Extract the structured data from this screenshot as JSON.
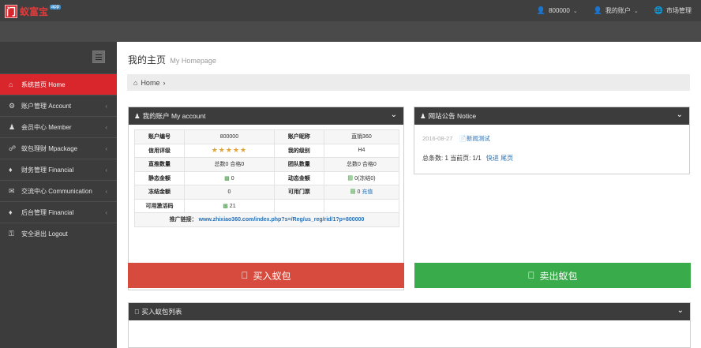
{
  "header": {
    "logo_mark": "门",
    "logo_text": "蚁富宝",
    "logo_badge": "app",
    "user_label": "800000",
    "account_label": "我的账户",
    "market_label": "市场管理"
  },
  "sidebar": {
    "items": [
      {
        "label": "系统首页 Home",
        "icon": "home-icon",
        "active": true
      },
      {
        "label": "账户管理 Account",
        "icon": "gear-icon"
      },
      {
        "label": "会员中心 Member",
        "icon": "user-icon"
      },
      {
        "label": "蚁包理财 Mpackage",
        "icon": "cart-icon"
      },
      {
        "label": "财务管理 Financial",
        "icon": "tag-icon"
      },
      {
        "label": "交流中心 Communication",
        "icon": "comments-icon"
      },
      {
        "label": "后台管理 Financial",
        "icon": "tag-icon"
      },
      {
        "label": "安全退出 Logout",
        "icon": "lock-icon"
      }
    ]
  },
  "main": {
    "title": "我的主页",
    "title_en": "My Homepage",
    "breadcrumb": "Home"
  },
  "account_panel": {
    "title": "我的账户 My account",
    "rows": [
      [
        "账户编号",
        "800000",
        "账户昵称",
        "直销360"
      ],
      [
        "信用评级",
        "★★★★★",
        "我的级别",
        "H4"
      ],
      [
        "直推数量",
        "总数0 合格0",
        "团队数量",
        "总数0 合格0"
      ],
      [
        "静态金额",
        "0",
        "动态金额",
        "0(冻结0)"
      ],
      [
        "冻结金额",
        "0",
        "可用门票",
        "0"
      ],
      [
        "可用激活码",
        "21"
      ]
    ],
    "recharge_label": "充值",
    "promo_label": "推广链接：",
    "promo_url": "www.zhixiao360.com/index.php?s=/Reg/us_reg/rid/1?p=800000"
  },
  "notice_panel": {
    "title": "网站公告 Notice",
    "date": "2016-08-27",
    "item_title": "新闻测试",
    "summary": "总条数: 1 当前页: 1/1",
    "nav": "快进 尾页"
  },
  "actions": {
    "buy_label": "买入蚁包",
    "sell_label": "卖出蚁包"
  },
  "buy_list": {
    "title": "买入蚁包列表"
  }
}
